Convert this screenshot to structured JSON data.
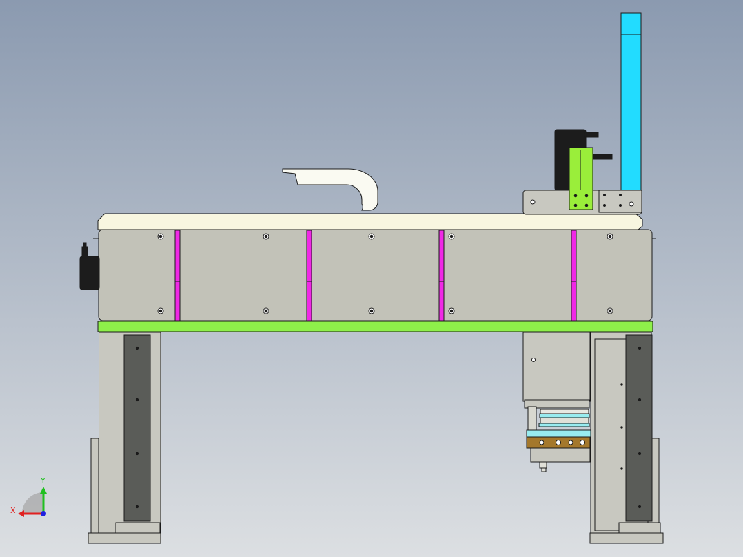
{
  "viewport": {
    "background_top": "#8b9ab0",
    "background_bottom": "#dcdfe2"
  },
  "colors": {
    "outline": "#1a1a1a",
    "panel_grey": "#c2c2b8",
    "panel_light": "#c8c8c0",
    "top_plate": "#f8f6e0",
    "green_plate": "#8ef04a",
    "green_bracket": "#9aee3a",
    "magenta_strip": "#f028e6",
    "cyan_beam": "#22dcff",
    "motor_black": "#1c1c1c",
    "slot_dark": "#5a5c58",
    "bronze_block": "#a4782c",
    "light_cyan": "#98ecf0",
    "axis_x": "#e02020",
    "axis_y": "#20c020",
    "axis_z": "#2020e0"
  },
  "triad": {
    "x_label": "X",
    "y_label": "Y"
  }
}
